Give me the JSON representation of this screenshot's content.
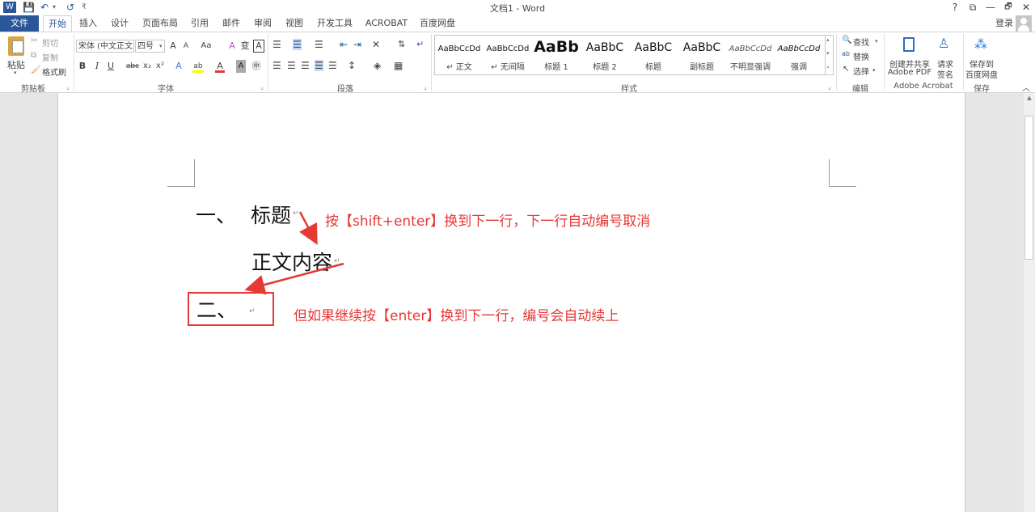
{
  "window": {
    "title": "文档1 - Word",
    "help": "?",
    "ribbon_display": "⧉",
    "minimize": "—",
    "restore": "🗗",
    "close": "✕"
  },
  "qat": {
    "word_icon": "W",
    "save_icon": "💾",
    "undo_icon": "↶",
    "undo_dd": "▾",
    "redo_icon": "↺",
    "customize": "₹"
  },
  "tabs": [
    {
      "label": "文件"
    },
    {
      "label": "开始"
    },
    {
      "label": "插入"
    },
    {
      "label": "设计"
    },
    {
      "label": "页面布局"
    },
    {
      "label": "引用"
    },
    {
      "label": "邮件"
    },
    {
      "label": "审阅"
    },
    {
      "label": "视图"
    },
    {
      "label": "开发工具"
    },
    {
      "label": "ACROBAT"
    },
    {
      "label": "百度网盘"
    }
  ],
  "account": {
    "login": "登录"
  },
  "clipboard": {
    "paste": "粘贴",
    "cut": "剪切",
    "copy": "复制",
    "format_painter": "格式刷",
    "group": "剪贴板"
  },
  "font": {
    "name": "宋体 (中文正文",
    "size": "四号",
    "grow": "A",
    "shrink": "A",
    "case": "Aa",
    "clear": "A",
    "phonetic": "变",
    "border": "A",
    "bold": "B",
    "italic": "I",
    "underline": "U",
    "strike": "abc",
    "sub": "x₂",
    "sup": "x²",
    "effects": "A",
    "highlight": "ab",
    "color": "A",
    "shading": "A",
    "enclose": "㊥",
    "group": "字体"
  },
  "paragraph": {
    "group": "段落"
  },
  "styles": {
    "group": "样式",
    "items": [
      {
        "sample": "AaBbCcDd",
        "name": "↵ 正文"
      },
      {
        "sample": "AaBbCcDd",
        "name": "↵ 无间隔"
      },
      {
        "sample": "AaBb",
        "name": "标题 1"
      },
      {
        "sample": "AaBbC",
        "name": "标题 2"
      },
      {
        "sample": "AaBbC",
        "name": "标题"
      },
      {
        "sample": "AaBbC",
        "name": "副标题"
      },
      {
        "sample": "AaBbCcDd",
        "name": "不明显强调"
      },
      {
        "sample": "AaBbCcDd",
        "name": "强调"
      }
    ]
  },
  "editing": {
    "find": "查找",
    "replace": "替换",
    "select": "选择",
    "group": "编辑"
  },
  "acrobat": {
    "create_share_1": "创建并共享",
    "create_share_2": "Adobe PDF",
    "request_sign_1": "请求",
    "request_sign_2": "签名",
    "group": "Adobe Acrobat"
  },
  "baidu": {
    "save_1": "保存到",
    "save_2": "百度网盘",
    "group": "保存"
  },
  "collapse": "︿",
  "document": {
    "line1_num": "一、",
    "line1_text": "标题",
    "line2_text": "正文内容",
    "line3_num": "二、",
    "para_mark": "↵"
  },
  "annotations": {
    "note1": "按【shift+enter】换到下一行，下一行自动编号取消",
    "note2": "但如果继续按【enter】换到下一行，编号会自动续上"
  },
  "colors": {
    "accent": "#2b579a",
    "annotation": "#e53935"
  }
}
